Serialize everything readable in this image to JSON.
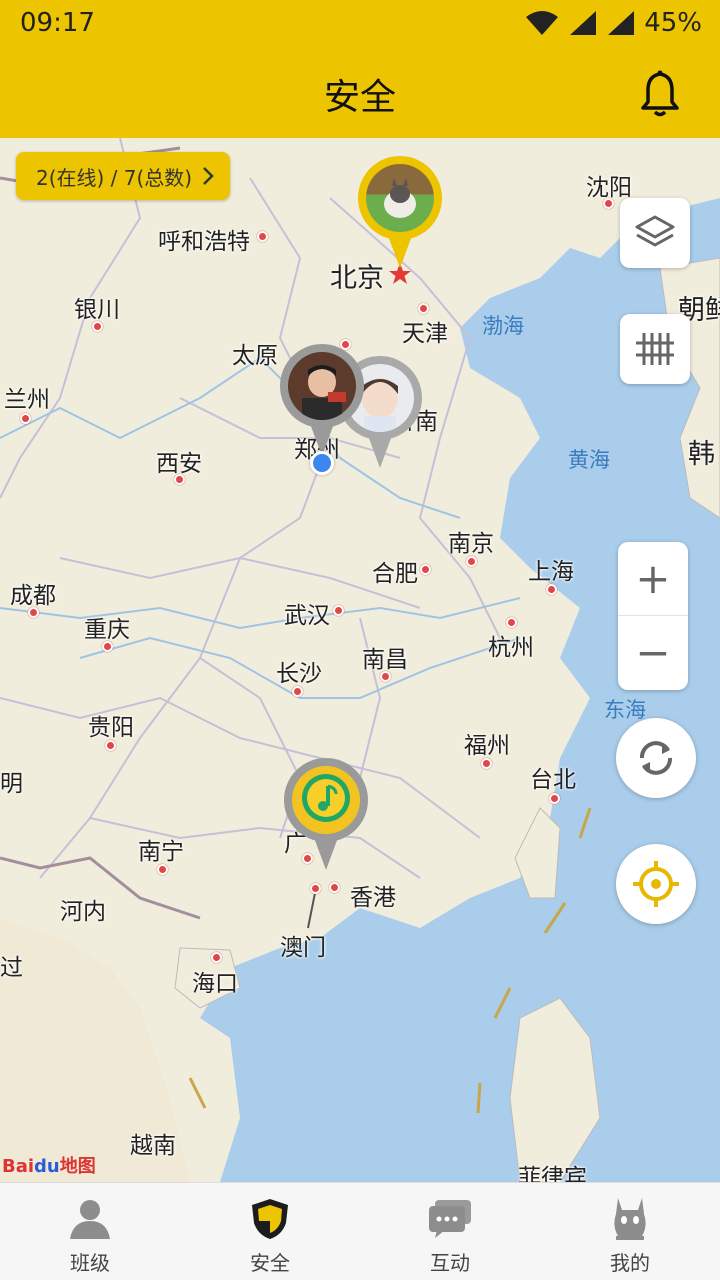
{
  "status": {
    "time": "09:17",
    "battery": "45%"
  },
  "header": {
    "title": "安全",
    "bell_icon": "bell-icon"
  },
  "map": {
    "online_summary": "2(在线) / 7(总数)",
    "cities": {
      "beijing": "北京",
      "tianjin": "天津",
      "shenyang": "沈阳",
      "hohhot": "呼和浩特",
      "yinchuan": "银川",
      "taiyuan": "太原",
      "lanzhou": "兰州",
      "xian": "西安",
      "zhengzhou": "郑州",
      "jinan": "济南",
      "nanjing": "南京",
      "hefei": "合肥",
      "shanghai": "上海",
      "chengdu": "成都",
      "chongqing": "重庆",
      "wuhan": "武汉",
      "hangzhou": "杭州",
      "changsha": "长沙",
      "nanchang": "南昌",
      "guiyang": "贵阳",
      "fuzhou": "福州",
      "taipei": "台北",
      "kunming": "明",
      "nanning": "南宁",
      "guangzhou": "广",
      "hongkong": "香港",
      "macau": "澳门",
      "hanoi": "河内",
      "haikou": "海口",
      "vietnam": "越南",
      "philippines": "菲律宾",
      "korea_n": "朝鲜",
      "korea_s": "韩",
      "laos": "过"
    },
    "seas": {
      "bohai": "渤海",
      "yellow": "黄海",
      "east": "东海"
    },
    "logo": {
      "bai": "Bai",
      "du": "du",
      "ditu": "地图"
    },
    "controls": {
      "layers": "layers-icon",
      "grid": "grid-icon",
      "zoom_in": "+",
      "zoom_out": "−",
      "refresh": "refresh-icon",
      "locate": "locate-icon"
    },
    "markers": [
      {
        "name": "dog-avatar",
        "color": "#ecc400"
      },
      {
        "name": "child-avatar-1",
        "color": "#9a9a9a"
      },
      {
        "name": "child-avatar-2",
        "color": "#a9a9a9"
      },
      {
        "name": "qq-music-avatar",
        "color": "#9a9a9a"
      }
    ]
  },
  "tabs": [
    {
      "label": "班级",
      "icon": "class-icon"
    },
    {
      "label": "安全",
      "icon": "shield-icon",
      "active": true
    },
    {
      "label": "互动",
      "icon": "chat-icon"
    },
    {
      "label": "我的",
      "icon": "profile-icon"
    }
  ],
  "colors": {
    "brand": "#ecc400",
    "sea": "#a9cdea",
    "land": "#f1eddc"
  }
}
